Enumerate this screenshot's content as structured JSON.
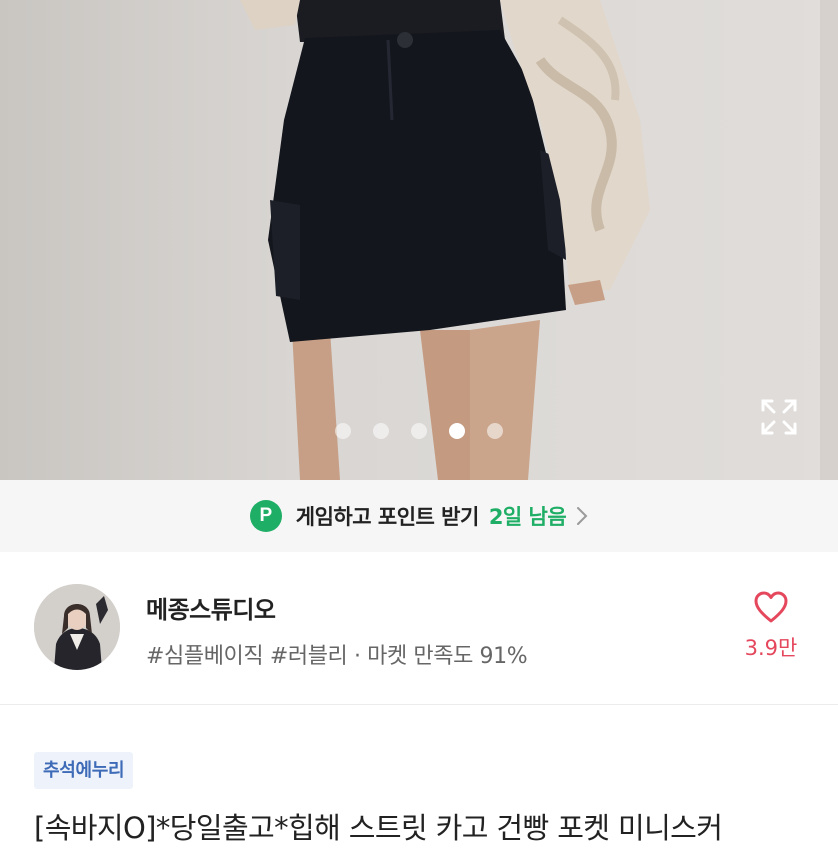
{
  "gallery": {
    "slide_count": 5,
    "active_index": 3,
    "expand_icon": "expand-icon"
  },
  "point_banner": {
    "icon_letter": "P",
    "text": "게임하고 포인트 받기",
    "days_left": "2일 남음",
    "accent": "#1fae65"
  },
  "store": {
    "name": "메종스튜디오",
    "tags": "#심플베이직 #러블리 · 마켓 만족도 91%",
    "like_count": "3.9만",
    "like_color": "#e5475d"
  },
  "product": {
    "badge": "추석에누리",
    "title": "[속바지O]*당일출고*힙해 스트릿 카고 건빵 포켓 미니스커"
  }
}
